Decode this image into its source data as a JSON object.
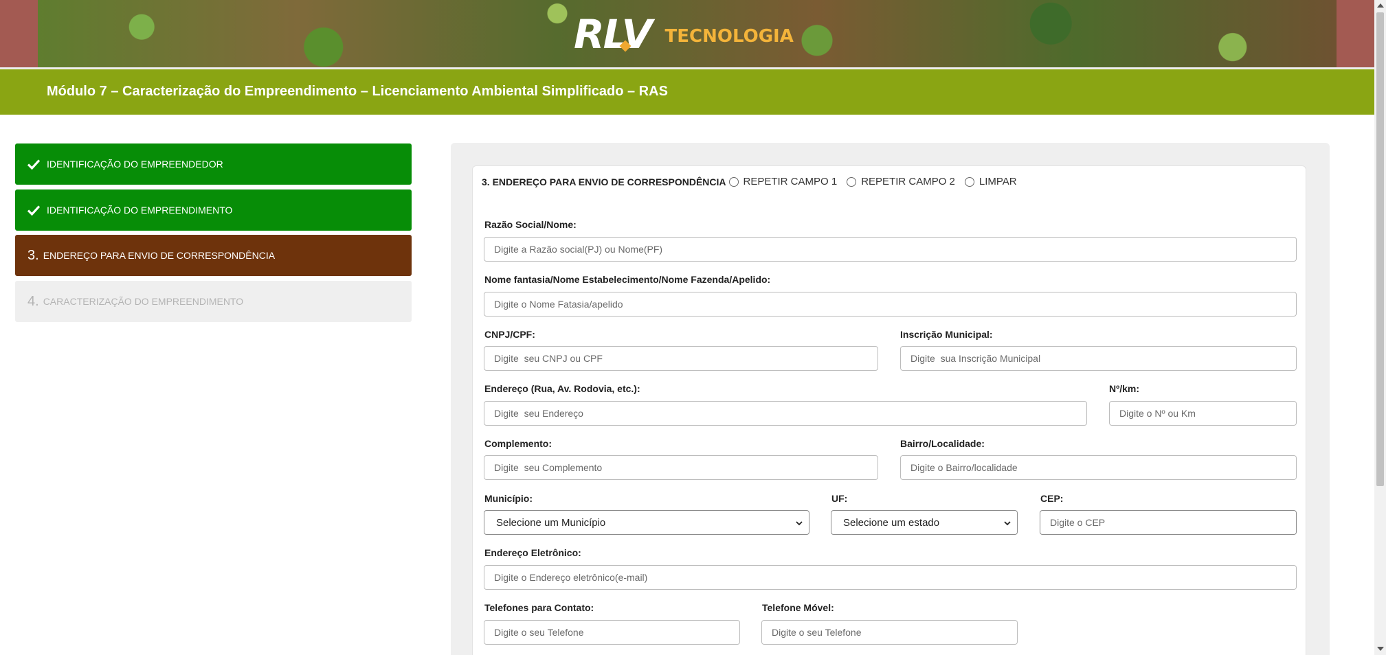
{
  "header": {
    "logo_text": "RLV",
    "logo_subtext": "TECNOLOGIA"
  },
  "title_bar": {
    "title": "Módulo 7 – Caracterização do Empreendimento – Licenciamento Ambiental Simplificado – RAS"
  },
  "steps": [
    {
      "label": "Identificação do Empreendedor",
      "status": "done",
      "number": ""
    },
    {
      "label": "Identificação do Empreendimento",
      "status": "done",
      "number": ""
    },
    {
      "label": "Endereço para envio de correspondência",
      "status": "active",
      "number": "3."
    },
    {
      "label": "Caracterização do Empreendimento",
      "status": "pending",
      "number": "4."
    }
  ],
  "colors": {
    "title_bar": "#8aa513",
    "step_done": "#078d07",
    "step_active": "#6e330c",
    "step_pending": "#efefef"
  },
  "form": {
    "section_title": "3. ENDEREÇO PARA ENVIO DE CORRESPONDÊNCIA",
    "options": [
      "REPETIR CAMPO 1",
      "REPETIR CAMPO 2",
      "LIMPAR"
    ],
    "fields": {
      "razao_social": {
        "label": "Razão Social/Nome:",
        "placeholder": "Digite a Razão social(PJ) ou Nome(PF)"
      },
      "nome_fantasia": {
        "label": "Nome fantasia/Nome Estabelecimento/Nome Fazenda/Apelido:",
        "placeholder": "Digite o Nome Fatasia/apelido"
      },
      "cnpj_cpf": {
        "label": "CNPJ/CPF:",
        "placeholder": "Digite  seu CNPJ ou CPF"
      },
      "inscricao_municipal": {
        "label": "Inscrição Municipal:",
        "placeholder": "Digite  sua Inscrição Municipal"
      },
      "endereco": {
        "label": "Endereço (Rua, Av. Rodovia, etc.):",
        "placeholder": "Digite  seu Endereço"
      },
      "numero": {
        "label": "Nº/km:",
        "placeholder": "Digite o Nº ou Km"
      },
      "complemento": {
        "label": "Complemento:",
        "placeholder": "Digite  seu Complemento"
      },
      "bairro": {
        "label": "Bairro/Localidade:",
        "placeholder": "Digite o Bairro/localidade"
      },
      "municipio": {
        "label": "Município:",
        "selected": "Selecione um Município"
      },
      "uf": {
        "label": "UF:",
        "selected": "Selecione um estado"
      },
      "cep": {
        "label": "CEP:",
        "placeholder": "Digite o CEP"
      },
      "email": {
        "label": "Endereço Eletrônico:",
        "placeholder": "Digite o Endereço eletrônico(e-mail)"
      },
      "telefone": {
        "label": "Telefones para Contato:",
        "placeholder": "Digite o seu Telefone"
      },
      "telefone_movel": {
        "label": "Telefone Móvel:",
        "placeholder": "Digite o seu Telefone"
      }
    }
  },
  "icons": {
    "done_step": "check-icon",
    "select": "chevron-down-icon"
  }
}
